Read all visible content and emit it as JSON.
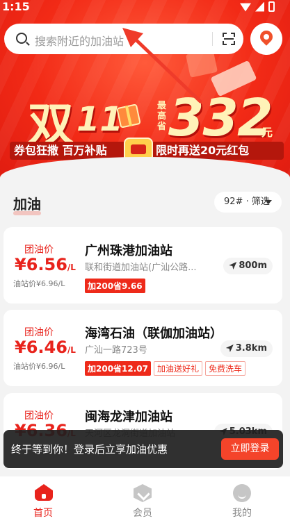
{
  "status_bar": {
    "time": "1:15"
  },
  "search": {
    "placeholder": "搜索附近的加油站"
  },
  "banner": {
    "headline": "双",
    "headline_number": "11",
    "max_label": "最高省",
    "amount": "332",
    "amount_unit": "元",
    "left_slogan": "券包狂撒 百万补贴",
    "right_slogan": "限时再送20元红包"
  },
  "section": {
    "title": "加油",
    "filter_label": "92# · 筛选"
  },
  "stations": [
    {
      "price_label": "团油价",
      "price": "¥6.56",
      "price_unit": "/L",
      "original_price": "油站价¥6.96/L",
      "name": "广州珠港加油站",
      "address": "联和街道加油站(广汕公路...",
      "distance": "800m",
      "tags": [
        "加200省9.66"
      ]
    },
    {
      "price_label": "团油价",
      "price": "¥6.46",
      "price_unit": "/L",
      "original_price": "油站价¥6.96/L",
      "name": "海湾石油（联伽加油站）",
      "address": "广汕一路723号",
      "distance": "3.8km",
      "tags": [
        "加200省12.07",
        "加油送好礼",
        "免费洗车"
      ]
    },
    {
      "price_label": "团油价",
      "price": "¥6.36",
      "price_unit": "/L",
      "original_price": "",
      "name": "闽海龙津加油站",
      "address": "天河区龙洞街道加油站",
      "distance": "5.03km",
      "tags": []
    }
  ],
  "toast": {
    "message": "终于等到你！登录后立享加油优惠",
    "action_label": "立即登录"
  },
  "tabbar": {
    "items": [
      {
        "label": "首页",
        "icon": "home-icon",
        "active": true
      },
      {
        "label": "会员",
        "icon": "member-icon",
        "active": false
      },
      {
        "label": "我的",
        "icon": "profile-icon",
        "active": false
      }
    ]
  },
  "colors": {
    "brand_red": "#e8231c",
    "toast_bg": "#1e1e1e",
    "cta": "#f4442a"
  }
}
